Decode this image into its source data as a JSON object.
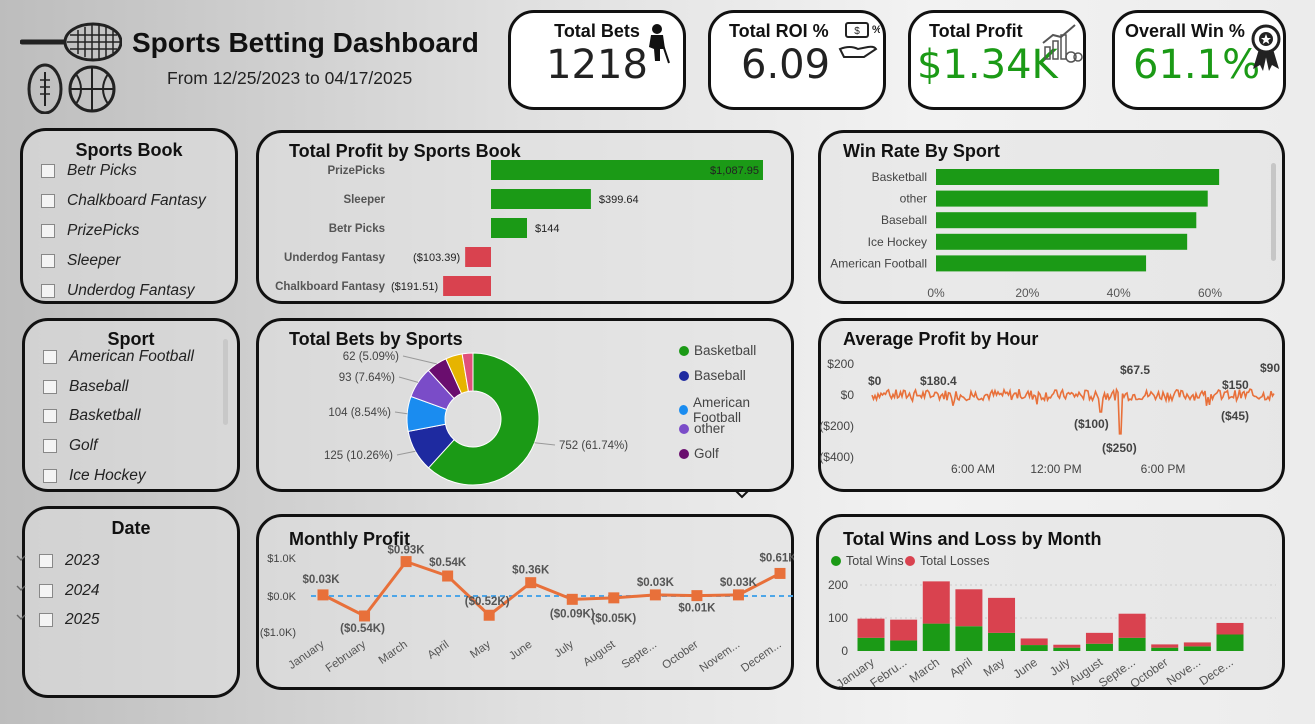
{
  "header": {
    "title": "Sports Betting Dashboard",
    "subtitle": "From 12/25/2023 to 04/17/2025"
  },
  "kpis": [
    {
      "label": "Total Bets",
      "value": "1218",
      "icon": "hockey-player-icon"
    },
    {
      "label": "Total ROI %",
      "value": "6.09",
      "icon": "money-hand-icon"
    },
    {
      "label": "Total Profit",
      "value": "$1.34K",
      "icon": "profit-chart-icon",
      "color": "#1b9a16"
    },
    {
      "label": "Overall Win %",
      "value": "61.1%",
      "icon": "award-ribbon-icon",
      "color": "#1b9a16"
    }
  ],
  "slicers": {
    "sportsbook": {
      "title": "Sports Book",
      "options": [
        "Betr Picks",
        "Chalkboard Fantasy",
        "PrizePicks",
        "Sleeper",
        "Underdog Fantasy"
      ]
    },
    "sport": {
      "title": "Sport",
      "options": [
        "American Football",
        "Baseball",
        "Basketball",
        "Golf",
        "Ice Hockey"
      ]
    },
    "date": {
      "title": "Date",
      "options": [
        "2023",
        "2024",
        "2025"
      ]
    }
  },
  "colors": {
    "green": "#1b9a16",
    "red": "#d9424f",
    "orange": "#e8703a",
    "blue": "#1e2aa0",
    "lightblue": "#1a8cf0",
    "purple": "#7a4cc8",
    "dpurple": "#6a0d6e",
    "yellow": "#e6b400",
    "pink": "#e0507a",
    "dashed": "#4da6e8"
  },
  "chart_data": [
    {
      "id": "profit_by_book",
      "type": "bar",
      "title": "Total Profit by Sports Book",
      "categories": [
        "PrizePicks",
        "Sleeper",
        "Betr Picks",
        "Underdog Fantasy",
        "Chalkboard Fantasy"
      ],
      "values": [
        1087.95,
        399.64,
        144,
        -103.39,
        -191.51
      ],
      "labels": [
        "$1,087.95",
        "$399.64",
        "$144",
        "($103.39)",
        "($191.51)"
      ]
    },
    {
      "id": "win_rate_by_sport",
      "type": "bar",
      "title": "Win Rate By Sport",
      "categories": [
        "Basketball",
        "other",
        "Baseball",
        "Ice Hockey",
        "American Football"
      ],
      "values": [
        62,
        59.5,
        57,
        55,
        46
      ],
      "xticks": [
        "0%",
        "20%",
        "40%",
        "60%"
      ],
      "xlim": [
        0,
        70
      ]
    },
    {
      "id": "bets_by_sport",
      "type": "pie",
      "title": "Total Bets by Sports",
      "slices": [
        {
          "name": "Basketball",
          "value": 752,
          "label": "752 (61.74%)"
        },
        {
          "name": "Baseball",
          "value": 125,
          "label": "125 (10.26%)"
        },
        {
          "name": "American Football",
          "value": 104,
          "label": "104 (8.54%)"
        },
        {
          "name": "other",
          "value": 93,
          "label": "93 (7.64%)"
        },
        {
          "name": "Golf",
          "value": 62,
          "label": "62 (5.09%)"
        },
        {
          "name": "",
          "value": 50,
          "label": ""
        },
        {
          "name": "",
          "value": 32,
          "label": ""
        }
      ],
      "legend": [
        "Basketball",
        "Baseball",
        "American Football",
        "other",
        "Golf"
      ]
    },
    {
      "id": "avg_profit_by_hour",
      "type": "line",
      "title": "Average Profit by Hour",
      "yticks": [
        "$200",
        "$0",
        "($200)",
        "($400)"
      ],
      "ylim": [
        -400,
        200
      ],
      "xticks": [
        "6:00 AM",
        "12:00 PM",
        "6:00 PM"
      ],
      "annotations": [
        "$0",
        "$180.4",
        "$67.5",
        "($100)",
        "($250)",
        "$150",
        "$90",
        "($45)"
      ]
    },
    {
      "id": "monthly_profit",
      "type": "line",
      "title": "Monthly Profit",
      "categories": [
        "January",
        "February",
        "March",
        "April",
        "May",
        "June",
        "July",
        "August",
        "Septe...",
        "October",
        "Novem...",
        "Decem..."
      ],
      "values": [
        0.03,
        -0.54,
        0.93,
        0.54,
        -0.52,
        0.36,
        -0.09,
        -0.05,
        0.03,
        0.01,
        0.03,
        0.61
      ],
      "labels": [
        "$0.03K",
        "($0.54K)",
        "$0.93K",
        "$0.54K",
        "($0.52K)",
        "$0.36K",
        "($0.09K)",
        "($0.05K)",
        "$0.03K",
        "$0.01K",
        "$0.03K",
        "$0.61K"
      ],
      "yticks": [
        "$1.0K",
        "$0.0K",
        "($1.0K)"
      ],
      "ylim": [
        -1.0,
        1.0
      ]
    },
    {
      "id": "wins_losses_by_month",
      "type": "bar",
      "title": "Total Wins and Loss by Month",
      "categories": [
        "January",
        "Febru...",
        "March",
        "April",
        "May",
        "June",
        "July",
        "August",
        "Septe...",
        "October",
        "Nove...",
        "Dece..."
      ],
      "series": [
        {
          "name": "Total Wins",
          "values": [
            40,
            32,
            83,
            75,
            55,
            18,
            10,
            22,
            40,
            10,
            14,
            50
          ]
        },
        {
          "name": "Total Losses",
          "values": [
            58,
            63,
            128,
            112,
            106,
            20,
            9,
            33,
            73,
            10,
            12,
            35
          ]
        }
      ],
      "yticks": [
        "200",
        "100",
        "0"
      ],
      "ylim": [
        0,
        230
      ]
    }
  ]
}
